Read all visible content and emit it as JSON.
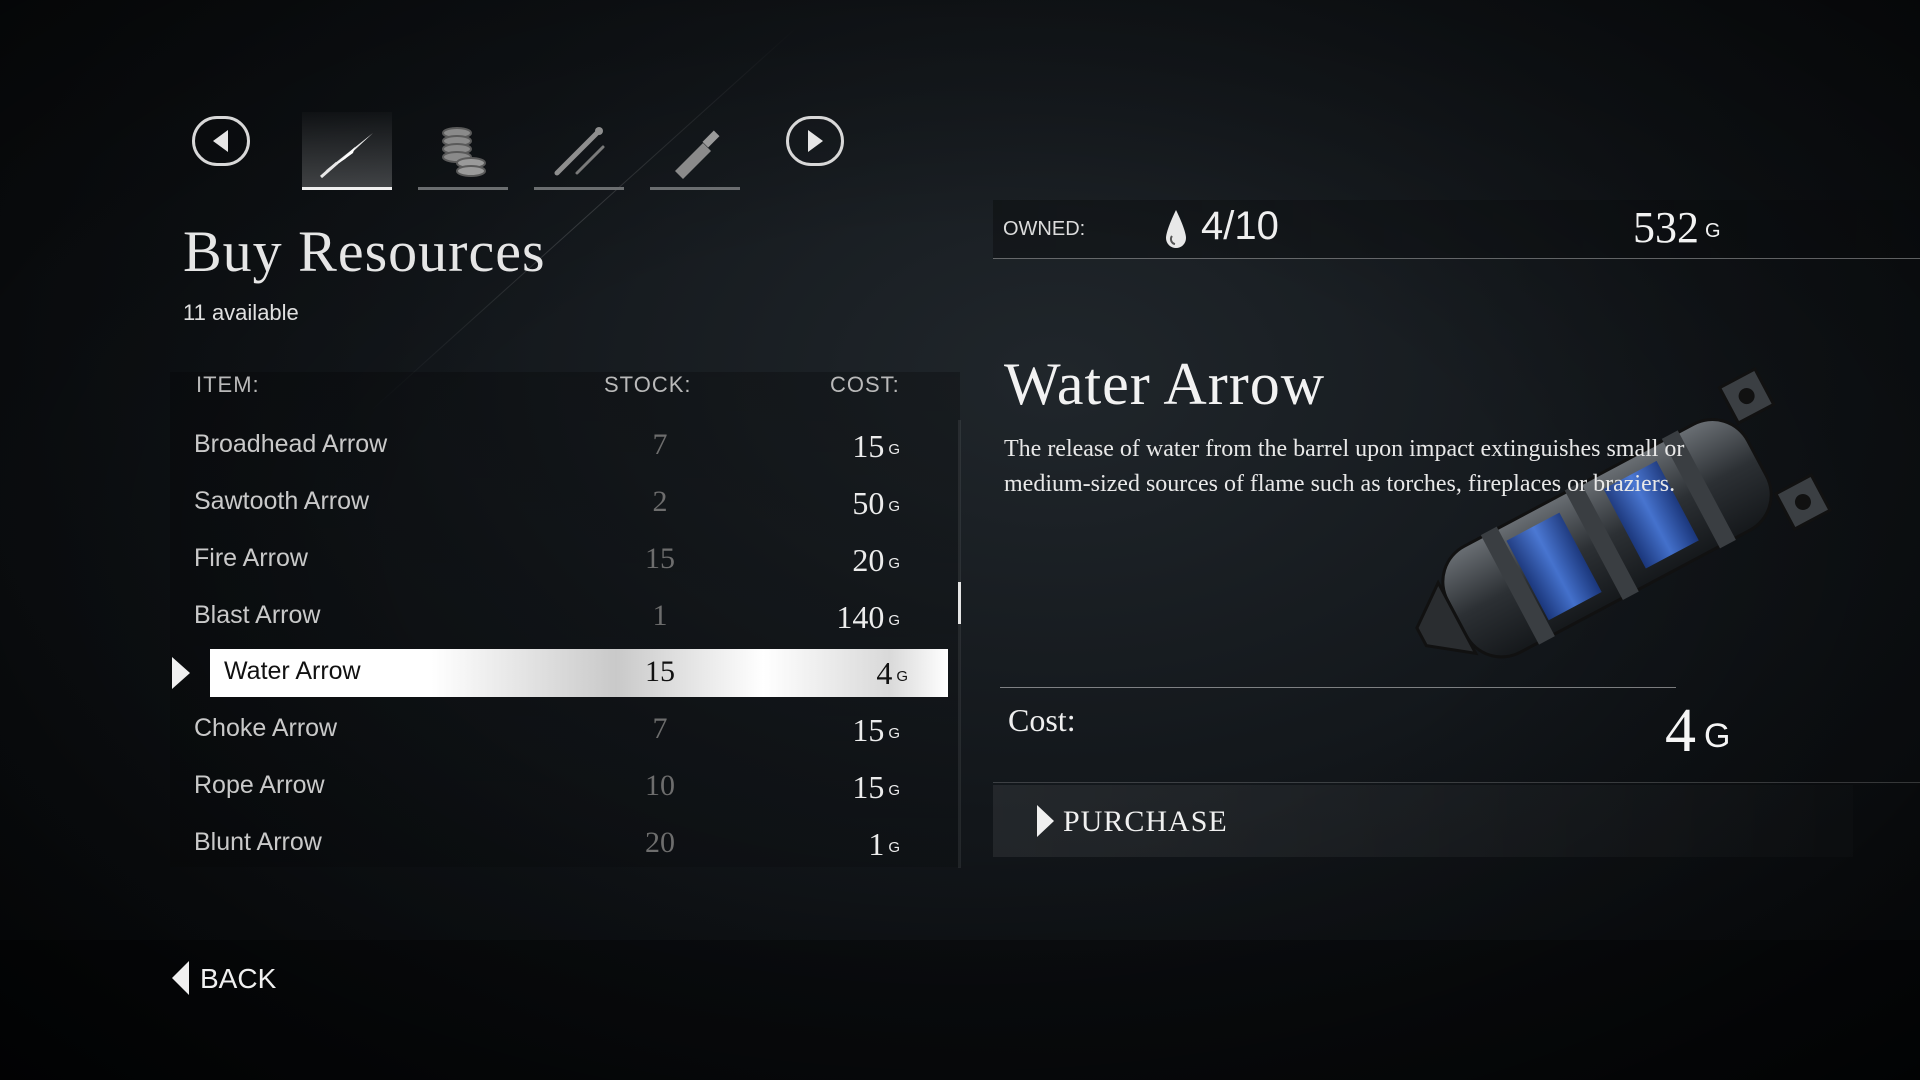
{
  "nav": {
    "prev_icon": "chevron-left-icon",
    "next_icon": "chevron-right-icon",
    "tabs": [
      {
        "icon": "arrow-icon",
        "active": true
      },
      {
        "icon": "coins-icon",
        "active": false
      },
      {
        "icon": "tool-icon",
        "active": false
      },
      {
        "icon": "bottle-icon",
        "active": false
      }
    ]
  },
  "header": {
    "title": "Buy Resources",
    "available": "11 available"
  },
  "table": {
    "col_item": "ITEM:",
    "col_stock": "STOCK:",
    "col_cost": "COST:",
    "currency": "G",
    "rows": [
      {
        "name": "Broadhead Arrow",
        "stock": "7",
        "cost": "15"
      },
      {
        "name": "Sawtooth Arrow",
        "stock": "2",
        "cost": "50"
      },
      {
        "name": "Fire Arrow",
        "stock": "15",
        "cost": "20"
      },
      {
        "name": "Blast Arrow",
        "stock": "1",
        "cost": "140"
      },
      {
        "name": "Water Arrow",
        "stock": "15",
        "cost": "4"
      },
      {
        "name": "Choke Arrow",
        "stock": "7",
        "cost": "15"
      },
      {
        "name": "Rope Arrow",
        "stock": "10",
        "cost": "15"
      },
      {
        "name": "Blunt Arrow",
        "stock": "20",
        "cost": "1"
      }
    ],
    "selected_index": 4
  },
  "status": {
    "owned_label": "OWNED:",
    "owned_icon": "water-drop-icon",
    "owned_value": "4/10",
    "gold": "532",
    "gold_unit": "G"
  },
  "detail": {
    "title": "Water Arrow",
    "description": "The release of water from the barrel upon impact extinguishes small or medium-sized sources of flame such as torches, fireplaces or braziers.",
    "cost_label": "Cost:",
    "cost_value": "4",
    "cost_unit": "G",
    "purchase_label": "PURCHASE"
  },
  "footer": {
    "back_label": "BACK"
  }
}
